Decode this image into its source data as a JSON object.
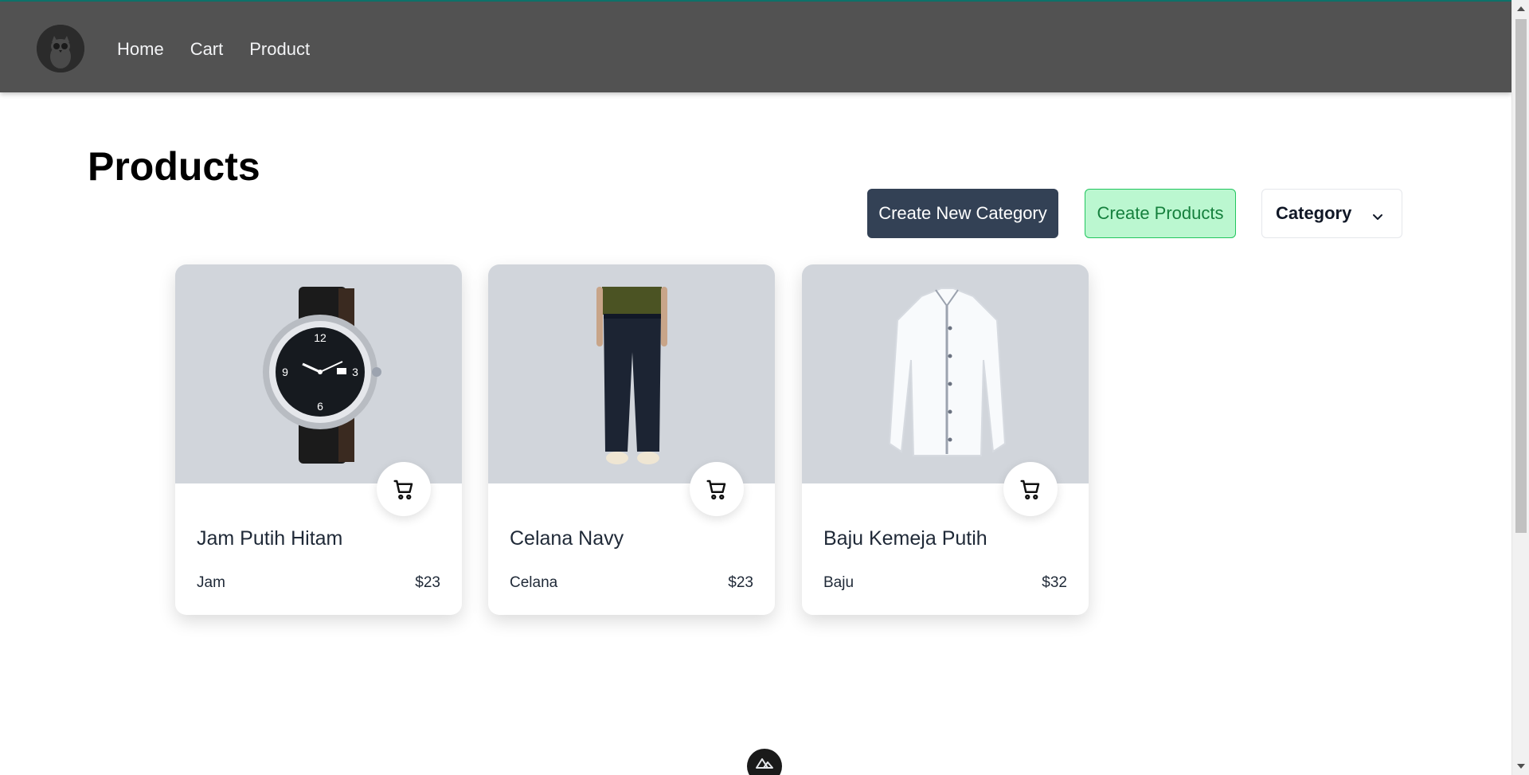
{
  "nav": {
    "logo_icon": "owl-avatar-icon",
    "links": [
      "Home",
      "Cart",
      "Product"
    ]
  },
  "page": {
    "title": "Products"
  },
  "actions": {
    "create_category": "Create New Category",
    "create_products": "Create Products",
    "category_select": "Category",
    "category_select_icon": "chevron-down-icon"
  },
  "products": [
    {
      "name": "Jam Putih Hitam",
      "category": "Jam",
      "price": "$23",
      "image": "wristwatch-image"
    },
    {
      "name": "Celana Navy",
      "category": "Celana",
      "price": "$23",
      "image": "navy-trousers-image"
    },
    {
      "name": "Baju Kemeja Putih",
      "category": "Baju",
      "price": "$32",
      "image": "white-shirt-image"
    }
  ],
  "colors": {
    "navbar": "#525252",
    "dark_button": "#334155",
    "green_button_bg": "#bbf7d0",
    "green_button_text": "#15803d",
    "card_image_bg": "#d1d5db"
  }
}
